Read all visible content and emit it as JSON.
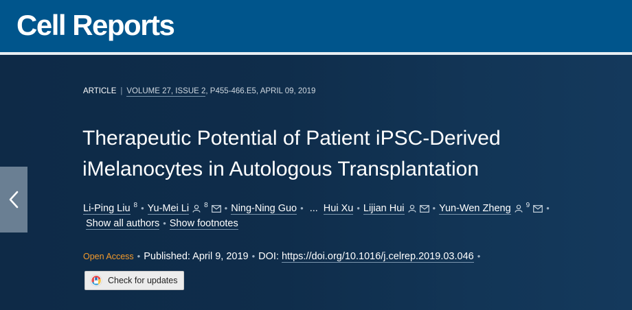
{
  "header": {
    "brand": "Cell Reports"
  },
  "nav": {
    "back_icon": "chevron-left-icon"
  },
  "article": {
    "type": "ARTICLE",
    "separator": "|",
    "volume_info": "VOLUME 27, ISSUE 2",
    "pages_date": ", P455-466.E5, APRIL 09, 2019",
    "title_line1": "Therapeutic Potential of Patient iPSC-Derived",
    "title_line2": "iMelanocytes in Autologous Transplantation"
  },
  "authors": [
    {
      "name": "Li-Ping Liu",
      "sup": "8"
    },
    {
      "name": "Yu-Mei Li",
      "sup": "8"
    },
    {
      "name": "Ning-Ning Guo"
    },
    {
      "name": "Hui Xu"
    },
    {
      "name": "Lijian Hui"
    },
    {
      "name": "Yun-Wen Zheng",
      "sup": "9"
    }
  ],
  "author_links": {
    "ellipsis": "...",
    "show_all": "Show all authors",
    "show_footnotes": "Show footnotes",
    "bullet": "•"
  },
  "publication": {
    "open_access": "Open Access",
    "published": "Published: April 9, 2019",
    "doi_label": "DOI:",
    "doi": "https://doi.org/10.1016/j.celrep.2019.03.046"
  },
  "updates_button": {
    "label": "Check for updates",
    "icon": "crossmark-icon"
  },
  "colors": {
    "header_bg": "#00558c",
    "page_bg": "#0e2a47",
    "open_access": "#f39a2b",
    "back_button": "#6a7f93"
  }
}
